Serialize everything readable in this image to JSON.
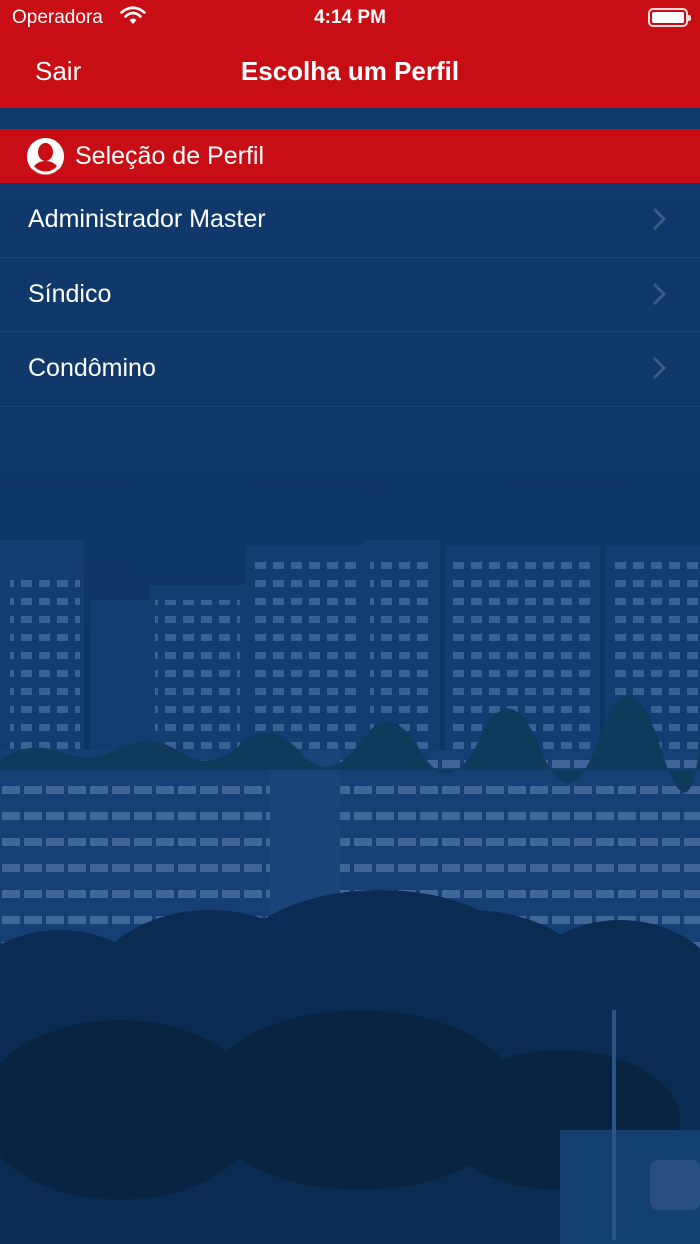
{
  "status_bar": {
    "carrier": "Operadora",
    "time": "4:14 PM"
  },
  "nav": {
    "back_label": "Sair",
    "title": "Escolha um Perfil"
  },
  "section": {
    "header_label": "Seleção de Perfil"
  },
  "profiles": [
    {
      "label": "Administrador Master"
    },
    {
      "label": "Síndico"
    },
    {
      "label": "Condômino"
    }
  ],
  "colors": {
    "accent_red": "#c80d14",
    "background_blue": "#0d3566"
  }
}
